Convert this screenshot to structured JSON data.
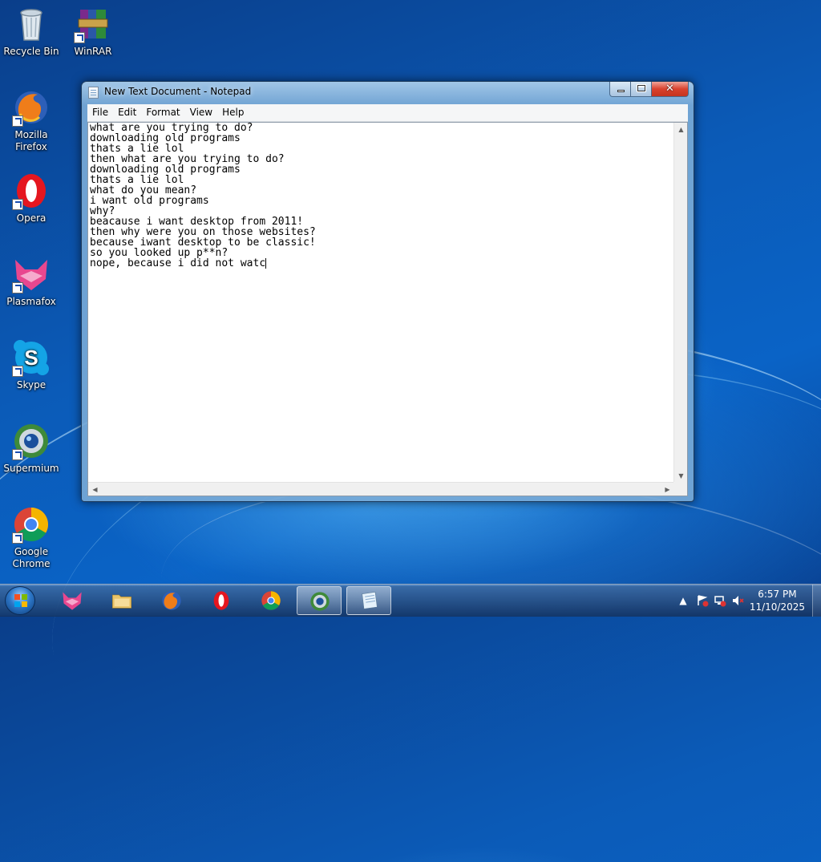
{
  "desktop": {
    "icons": [
      {
        "label": "Recycle Bin",
        "icon": "recycle-bin-icon"
      },
      {
        "label": "WinRAR",
        "icon": "winrar-icon"
      },
      {
        "label": "Mozilla Firefox",
        "icon": "firefox-icon"
      },
      {
        "label": "Opera",
        "icon": "opera-icon"
      },
      {
        "label": "Plasmafox",
        "icon": "plasmafox-icon"
      },
      {
        "label": "Skype",
        "icon": "skype-icon"
      },
      {
        "label": "Supermium",
        "icon": "supermium-icon"
      },
      {
        "label": "Google Chrome",
        "icon": "chrome-icon"
      }
    ]
  },
  "window": {
    "title": "New Text Document - Notepad",
    "menu": [
      "File",
      "Edit",
      "Format",
      "View",
      "Help"
    ],
    "text": "what are you trying to do?\ndownloading old programs\nthats a lie lol\nthen what are you trying to do?\ndownloading old programs\nthats a lie lol\nwhat do you mean?\ni want old programs\nwhy?\nbeacause i want desktop from 2011!\nthen why were you on those websites?\nbecause iwant desktop to be classic!\nso you looked up p**n?\nnope, because i did not watc"
  },
  "taskbar": {
    "apps": [
      "Plasmafox",
      "Windows Explorer",
      "Mozilla Firefox",
      "Opera",
      "Google Chrome",
      "Supermium",
      "Notepad"
    ],
    "active_app": "Notepad",
    "clock": {
      "time": "6:57 PM",
      "date": "11/10/2025"
    },
    "colors": {
      "accent": "#1d5fb3",
      "close_button": "#d9422e"
    }
  }
}
